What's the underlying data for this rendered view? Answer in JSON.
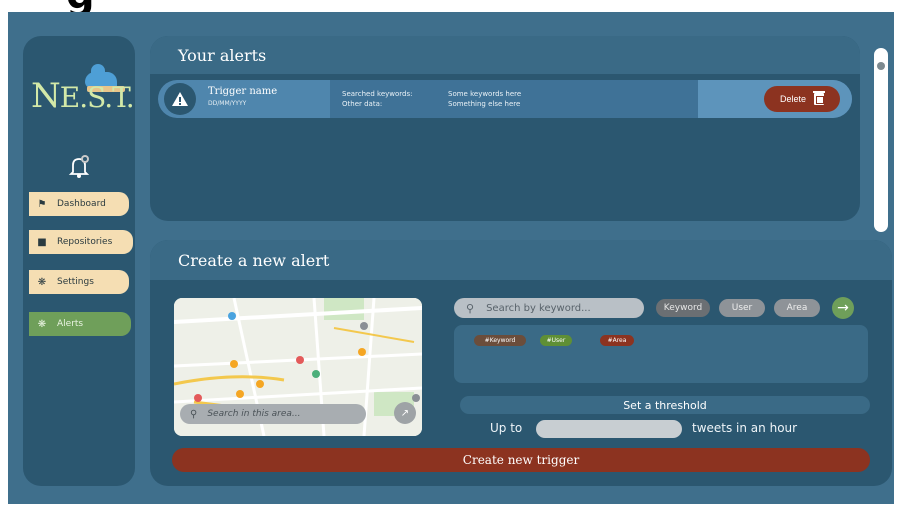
{
  "brand": {
    "logo_text_main": "N",
    "logo_text_rest": "E.S.T."
  },
  "sidebar": {
    "items": [
      {
        "label": "Dashboard",
        "icon": "home-icon"
      },
      {
        "label": "Repositories",
        "icon": "folder-icon"
      },
      {
        "label": "Settings",
        "icon": "gear-icon"
      },
      {
        "label": "Alerts",
        "icon": "gear-icon",
        "active": true
      }
    ]
  },
  "alerts": {
    "title": "Your alerts",
    "rows": [
      {
        "trigger_name": "Trigger name",
        "date": "DD/MM/YYYY",
        "label_keywords": "Searched keywords:",
        "value_keywords": "Some keywords here",
        "label_other": "Other data:",
        "value_other": "Something else here",
        "delete_label": "Delete"
      }
    ]
  },
  "create": {
    "title": "Create a new alert",
    "map_search_placeholder": "Search in this area...",
    "keyword_search_placeholder": "Search by keyword...",
    "filter_pills": [
      "Keyword",
      "User",
      "Area"
    ],
    "tags": [
      "#Keyword",
      "#User",
      "#Area"
    ],
    "threshold_label": "Set a threshold",
    "upto_label": "Up to",
    "tweets_label": "tweets in an hour",
    "create_button_label": "Create new trigger"
  },
  "colors": {
    "accent_red": "#8c3320",
    "accent_green": "#6f9f5a",
    "panel": "#2b5770",
    "background": "#3f6f8c",
    "cream": "#f5deb3"
  }
}
